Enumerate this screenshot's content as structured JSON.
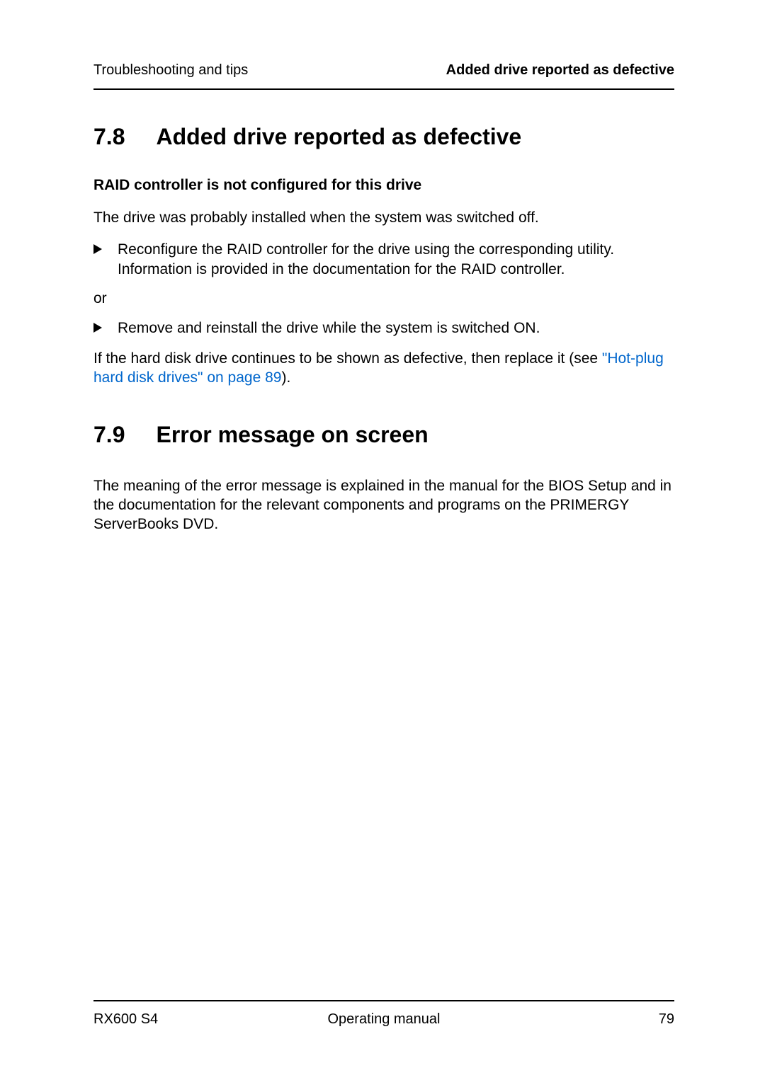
{
  "header": {
    "left": "Troubleshooting and tips",
    "right": "Added drive reported as defective"
  },
  "section1": {
    "num": "7.8",
    "title": "Added drive reported as defective",
    "subheading": "RAID controller is not configured for this drive",
    "intro": "The drive was probably installed when the system was switched off.",
    "bullet1": "Reconfigure the RAID controller for the drive using the corresponding utility. Information is provided in the documentation for the RAID controller.",
    "or": "or",
    "bullet2": "Remove and reinstall the drive while the system is switched ON.",
    "closing_pre": "If the hard disk drive continues to be shown as defective, then replace it (see ",
    "closing_link": "\"Hot-plug hard disk drives\" on page 89",
    "closing_post": ")."
  },
  "section2": {
    "num": "7.9",
    "title": "Error message on screen",
    "body": "The meaning of the error message is explained in the manual for the BIOS Setup and in the documentation for the relevant components and programs on the PRIMERGY ServerBooks DVD."
  },
  "footer": {
    "left": "RX600 S4",
    "center": "Operating manual",
    "right": "79"
  }
}
